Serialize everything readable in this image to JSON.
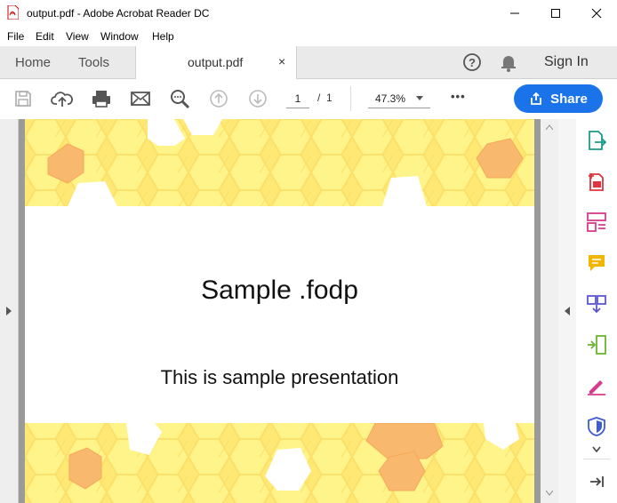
{
  "window": {
    "title": "output.pdf - Adobe Acrobat Reader DC"
  },
  "menu": {
    "items": [
      "File",
      "Edit",
      "View",
      "Window",
      "Help"
    ]
  },
  "tabs": {
    "home": "Home",
    "tools": "Tools",
    "doc": "output.pdf",
    "close": "×",
    "sign_in": "Sign In"
  },
  "toolbar": {
    "page_current": "1",
    "page_sep": "/",
    "page_total": "1",
    "zoom": "47.3%",
    "more": "•••",
    "share": "Share"
  },
  "slide": {
    "title": "Sample .fodp",
    "subtitle": "This is sample presentation"
  },
  "colors": {
    "accent": "#1a73e8",
    "honey_light": "#fff27a",
    "honey_mid": "#fde36a",
    "honey_orange": "#f7b96b"
  },
  "icons": {
    "toolbar": [
      "save-icon",
      "upload-cloud-icon",
      "print-icon",
      "mail-icon",
      "zoom-search-icon",
      "page-up-icon",
      "page-down-icon"
    ],
    "right_panel": [
      "export-pdf-icon",
      "create-pdf-icon",
      "organize-pages-icon",
      "comment-icon",
      "combine-files-icon",
      "compress-icon",
      "fill-sign-icon",
      "protect-icon",
      "expand-panel-icon"
    ]
  }
}
